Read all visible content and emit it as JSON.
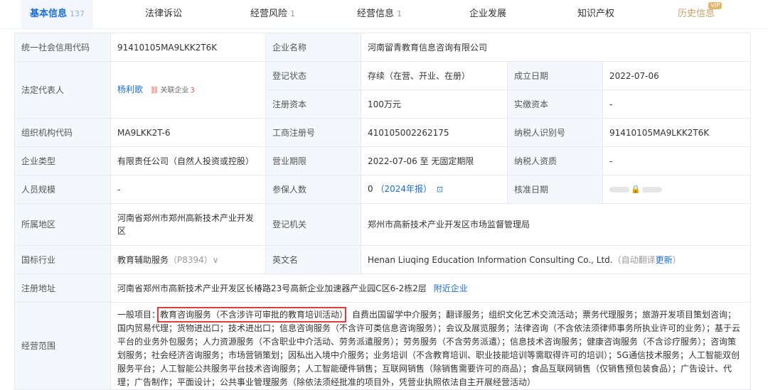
{
  "tabs": [
    {
      "label": "基本信息",
      "count": "137"
    },
    {
      "label": "法律诉讼",
      "count": ""
    },
    {
      "label": "经营风险",
      "count": "1"
    },
    {
      "label": "经营信息",
      "count": "1"
    },
    {
      "label": "企业发展",
      "count": ""
    },
    {
      "label": "知识产权",
      "count": ""
    },
    {
      "label": "历史信息",
      "count": "",
      "badge": "VIP"
    }
  ],
  "info": {
    "credit_code_label": "统一社会信用代码",
    "credit_code": "91410105MA9LKK2T6K",
    "company_name_label": "企业名称",
    "company_name": "河南留青教育信息咨询有限公司",
    "legal_rep_label": "法定代表人",
    "legal_rep": "杨利歌",
    "related_label": "关联企业",
    "related_count": "3",
    "reg_status_label": "登记状态",
    "reg_status": "存续（在营、开业、在册）",
    "est_date_label": "成立日期",
    "est_date": "2022-07-06",
    "reg_capital_label": "注册资本",
    "reg_capital": "100万元",
    "paid_capital_label": "实缴资本",
    "paid_capital": "-",
    "org_code_label": "组织机构代码",
    "org_code": "MA9LKK2T-6",
    "biz_reg_no_label": "工商注册号",
    "biz_reg_no": "410105002262175",
    "taxpayer_id_label": "纳税人识别号",
    "taxpayer_id": "91410105MA9LKK2T6K",
    "company_type_label": "企业类型",
    "company_type": "有限责任公司（自然人投资或控股）",
    "biz_term_label": "营业期限",
    "biz_term": "2022-07-06 至 无固定期限",
    "taxpayer_qual_label": "纳税人资质",
    "taxpayer_qual": "-",
    "staff_size_label": "人员规模",
    "staff_size": "-",
    "insured_label": "参保人数",
    "insured": "0",
    "insured_report": "（2024年报）",
    "approval_date_label": "核准日期",
    "region_label": "所属地区",
    "region": "河南省郑州市郑州高新技术产业开发区",
    "authority_label": "登记机关",
    "authority": "郑州市高新技术产业开发区市场监督管理局",
    "industry_label": "国标行业",
    "industry": "教育辅助服务",
    "industry_code": "（P8394）",
    "english_name_label": "英文名",
    "english_name": "Henan Liuqing Education Information Consulting Co., Ltd.",
    "auto_translate": "（自动翻译",
    "update": "更新",
    "close_paren": "）",
    "address_label": "注册地址",
    "address": "河南省郑州市高新技术产业开发区长椿路23号高新企业加速器产业园C区6-2栋2层",
    "nearby": "附近企业",
    "scope_label": "经营范围",
    "scope_prefix": "一般项目：",
    "scope_highlight": "教育咨询服务（不含涉许可审批的教育培训活动）",
    "scope_rest": "；自费出国留学中介服务；翻译服务；组织文化艺术交流活动；票务代理服务；旅游开发项目策划咨询；国内贸易代理；货物进出口；技术进出口；信息咨询服务（不含许可类信息咨询服务）；会议及展览服务；法律咨询（不含依法须律师事务所执业许可的业务）；基于云平台的业务外包服务；人力资源服务（不含职业中介活动、劳务派遣服务）；劳务服务（不含劳务派遣）；信息技术咨询服务；健康咨询服务（不含诊疗服务）；咨询策划服务；社会经济咨询服务；市场营销策划；因私出入境中介服务；业务培训（不含教育培训、职业技能培训等需取得许可的培训）；5G通信技术服务；人工智能双创服务平台；人工智能公共服务平台技术咨询服务；人工智能硬件销售；互联网销售（除销售需要许可的商品）；食品互联网销售（仅销售预包装食品）；广告设计、代理；广告制作；平面设计；公共事业管理服务（除依法须经批准的项目外，凭营业执照依法自主开展经营活动）"
  },
  "colors": {
    "accent": "#1a6dd8",
    "label_bg": "#f4f7fb",
    "highlight_box": "#e33b3b"
  }
}
